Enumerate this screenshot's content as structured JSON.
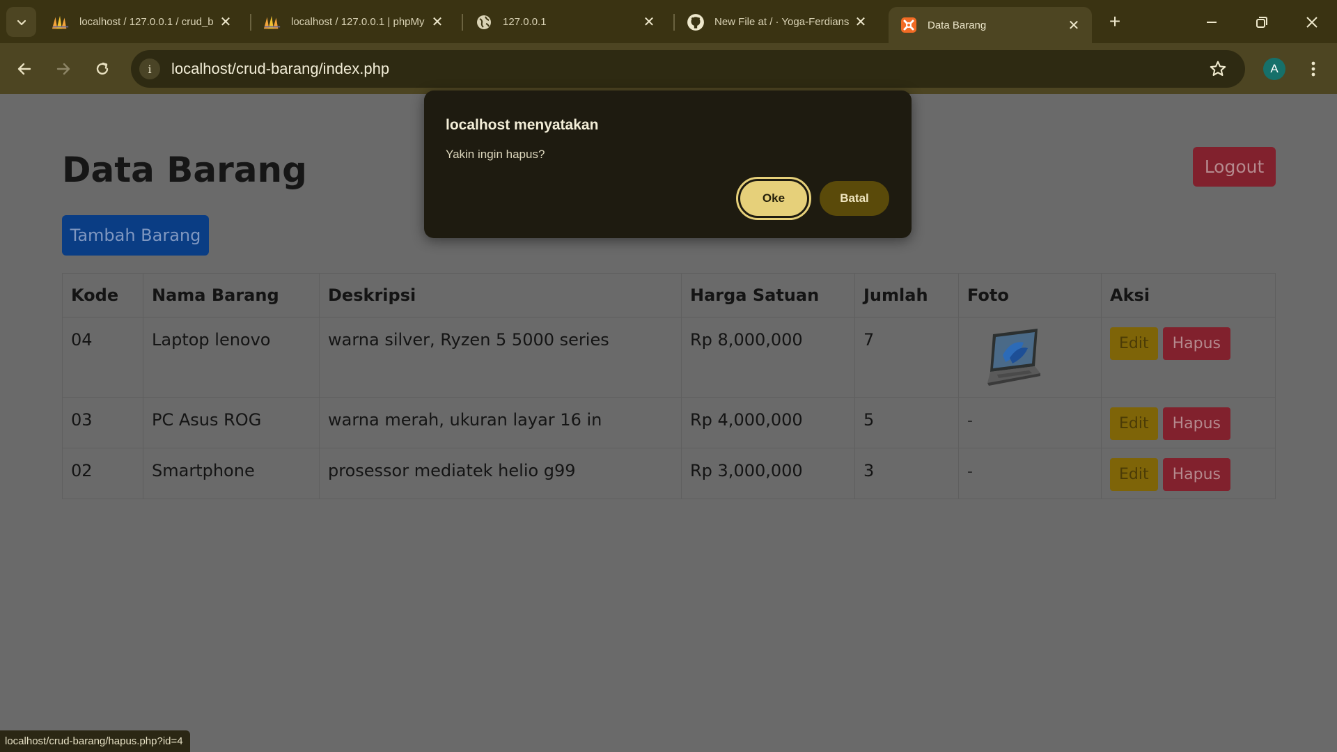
{
  "browser": {
    "tabs": [
      {
        "title": "localhost / 127.0.0.1 / crud_b",
        "icon": "phpmyadmin-icon"
      },
      {
        "title": "localhost / 127.0.0.1 | phpMy",
        "icon": "phpmyadmin-icon"
      },
      {
        "title": "127.0.0.1",
        "icon": "globe-icon"
      },
      {
        "title": "New File at / · Yoga-Ferdians",
        "icon": "github-icon"
      },
      {
        "title": "Data Barang",
        "icon": "xampp-icon",
        "active": true
      }
    ],
    "url": "localhost/crud-barang/index.php",
    "profile_initial": "A",
    "status_url": "localhost/crud-barang/hapus.php?id=4"
  },
  "page": {
    "title": "Data Barang",
    "logout_label": "Logout",
    "add_label": "Tambah Barang",
    "table": {
      "headers": [
        "Kode",
        "Nama Barang",
        "Deskripsi",
        "Harga Satuan",
        "Jumlah",
        "Foto",
        "Aksi"
      ],
      "rows": [
        {
          "kode": "04",
          "nama": "Laptop lenovo",
          "deskripsi": "warna silver, Ryzen 5 5000 series",
          "harga": "Rp 8,000,000",
          "jumlah": "7",
          "foto": "laptop-image"
        },
        {
          "kode": "03",
          "nama": "PC Asus ROG",
          "deskripsi": "warna merah, ukuran layar 16 in",
          "harga": "Rp 4,000,000",
          "jumlah": "5",
          "foto": "-"
        },
        {
          "kode": "02",
          "nama": "Smartphone",
          "deskripsi": "prosessor mediatek helio g99",
          "harga": "Rp 3,000,000",
          "jumlah": "3",
          "foto": "-"
        }
      ],
      "edit_label": "Edit",
      "delete_label": "Hapus"
    }
  },
  "dialog": {
    "title": "localhost menyatakan",
    "message": "Yakin ingin hapus?",
    "ok_label": "Oke",
    "cancel_label": "Batal"
  },
  "colors": {
    "chrome_dark": "#3a3312",
    "chrome_toolbar": "#4d4522",
    "dialog_bg": "#1e1b10",
    "ok_button": "#e6d07a",
    "cancel_button": "#5a4a0a"
  }
}
